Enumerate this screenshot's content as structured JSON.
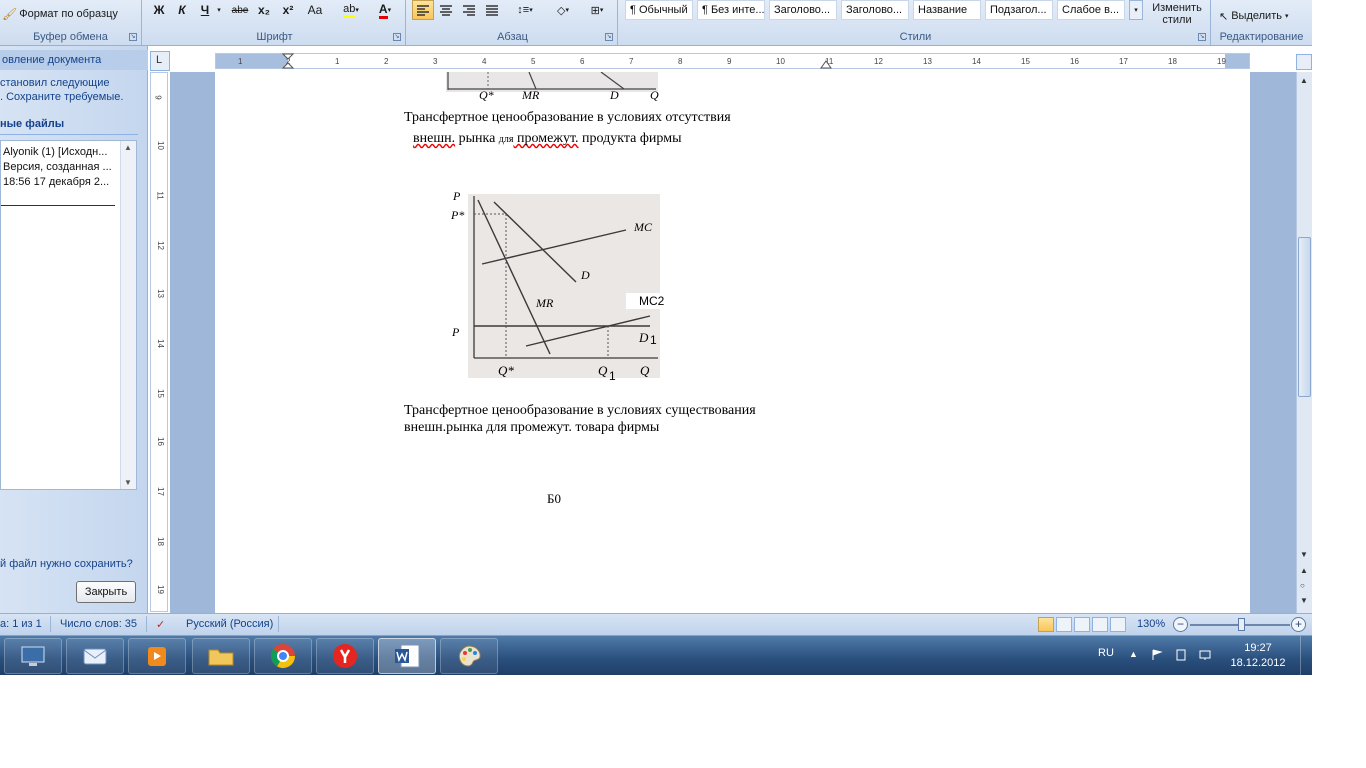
{
  "ribbon": {
    "clipboard": {
      "format_painter": "Формат по образцу",
      "group_label": "Буфер обмена"
    },
    "font": {
      "bold": "Ж",
      "italic": "К",
      "underline": "Ч",
      "strike": "abe",
      "subscript": "x₂",
      "superscript": "x²",
      "case": "Aa",
      "group_label": "Шрифт"
    },
    "paragraph": {
      "group_label": "Абзац"
    },
    "styles": {
      "tiles": [
        "¶ Обычный",
        "¶ Без инте...",
        "Заголово...",
        "Заголово...",
        "Название",
        "Подзагол...",
        "Слабое в..."
      ],
      "change_styles": "Изменить стили",
      "group_label": "Стили"
    },
    "editing": {
      "select": "Выделить",
      "group_label": "Редактирование"
    }
  },
  "taskpane": {
    "title": "овление документа",
    "message_line1": "становил следующие",
    "message_line2": ". Сохраните требуемые.",
    "files_title": "ные файлы",
    "file_line1": "Alyonik (1)  [Исходн...",
    "file_line2": "Версия, созданная ...",
    "file_line3": "18:56 17 декабря 2...",
    "question": "й файл нужно сохранить?",
    "close_button": "Закрыть"
  },
  "ruler": {
    "corner": "L",
    "ticks": [
      "1",
      "2",
      "1",
      "2",
      "3",
      "4",
      "5",
      "6",
      "7",
      "8",
      "9",
      "10",
      "11",
      "12",
      "13",
      "14",
      "15",
      "16",
      "17",
      "18",
      "19"
    ],
    "vticks": [
      "9",
      "10",
      "11",
      "12",
      "13",
      "14",
      "15",
      "16",
      "17",
      "18",
      "19"
    ]
  },
  "document": {
    "graph1_labels": {
      "q_star": "Q*",
      "mr": "MR",
      "d": "D",
      "q": "Q"
    },
    "caption1_line1": "Трансфертное  ценообразование  в  условиях  отсутствия",
    "caption1_line2_a": "внешн.",
    "caption1_line2_b": " рынка ",
    "caption1_line2_small": "для",
    "caption1_line2_c": " промежут.",
    "caption1_line2_d": " продукта фирмы",
    "graph2_labels": {
      "p": "P",
      "p_star": "P*",
      "mc": "MC",
      "d": "D",
      "mr": "MR",
      "mc2": "MC2",
      "p1": "P",
      "d1": "D",
      "d1_sub": "1",
      "q_star": "Q*",
      "q1": "Q",
      "q1_sub": "1",
      "q": "Q"
    },
    "caption2_line1": "Трансфертное ценообразование в условиях существования",
    "caption2_line2": "внешн.рынка для промежут. товара фирмы",
    "page_mark": "Б0"
  },
  "statusbar": {
    "page": "а: 1 из 1",
    "words": "Число слов: 35",
    "language": "Русский (Россия)",
    "zoom": "130%"
  },
  "taskbar": {
    "lang": "RU",
    "time": "19:27",
    "date": "18.12.2012"
  },
  "colors": {
    "ribbon_bg": "#d4e1f3",
    "doc_bg": "#9fb7d8",
    "taskbar": "#2a4f7d",
    "accent": "#15428b"
  }
}
